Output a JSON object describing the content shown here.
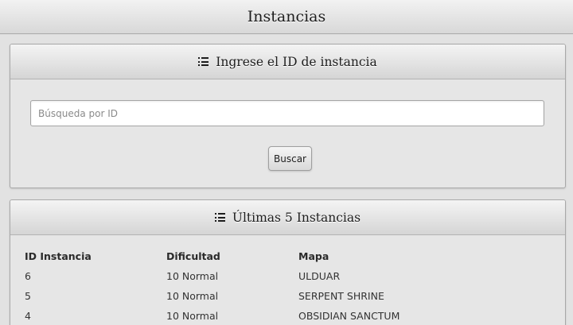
{
  "header": {
    "title": "Instancias"
  },
  "search": {
    "heading": "Ingrese el ID de instancia",
    "placeholder": "Búsqueda por ID",
    "value": "",
    "button_label": "Buscar"
  },
  "latest": {
    "heading": "Últimas 5 Instancias",
    "columns": [
      "ID Instancia",
      "Dificultad",
      "Mapa"
    ],
    "rows": [
      [
        "6",
        "10 Normal",
        "ULDUAR"
      ],
      [
        "5",
        "10 Normal",
        "SERPENT SHRINE"
      ],
      [
        "4",
        "10 Normal",
        "OBSIDIAN SANCTUM"
      ]
    ]
  },
  "icons": {
    "panel_heading_icon": "list-icon"
  }
}
